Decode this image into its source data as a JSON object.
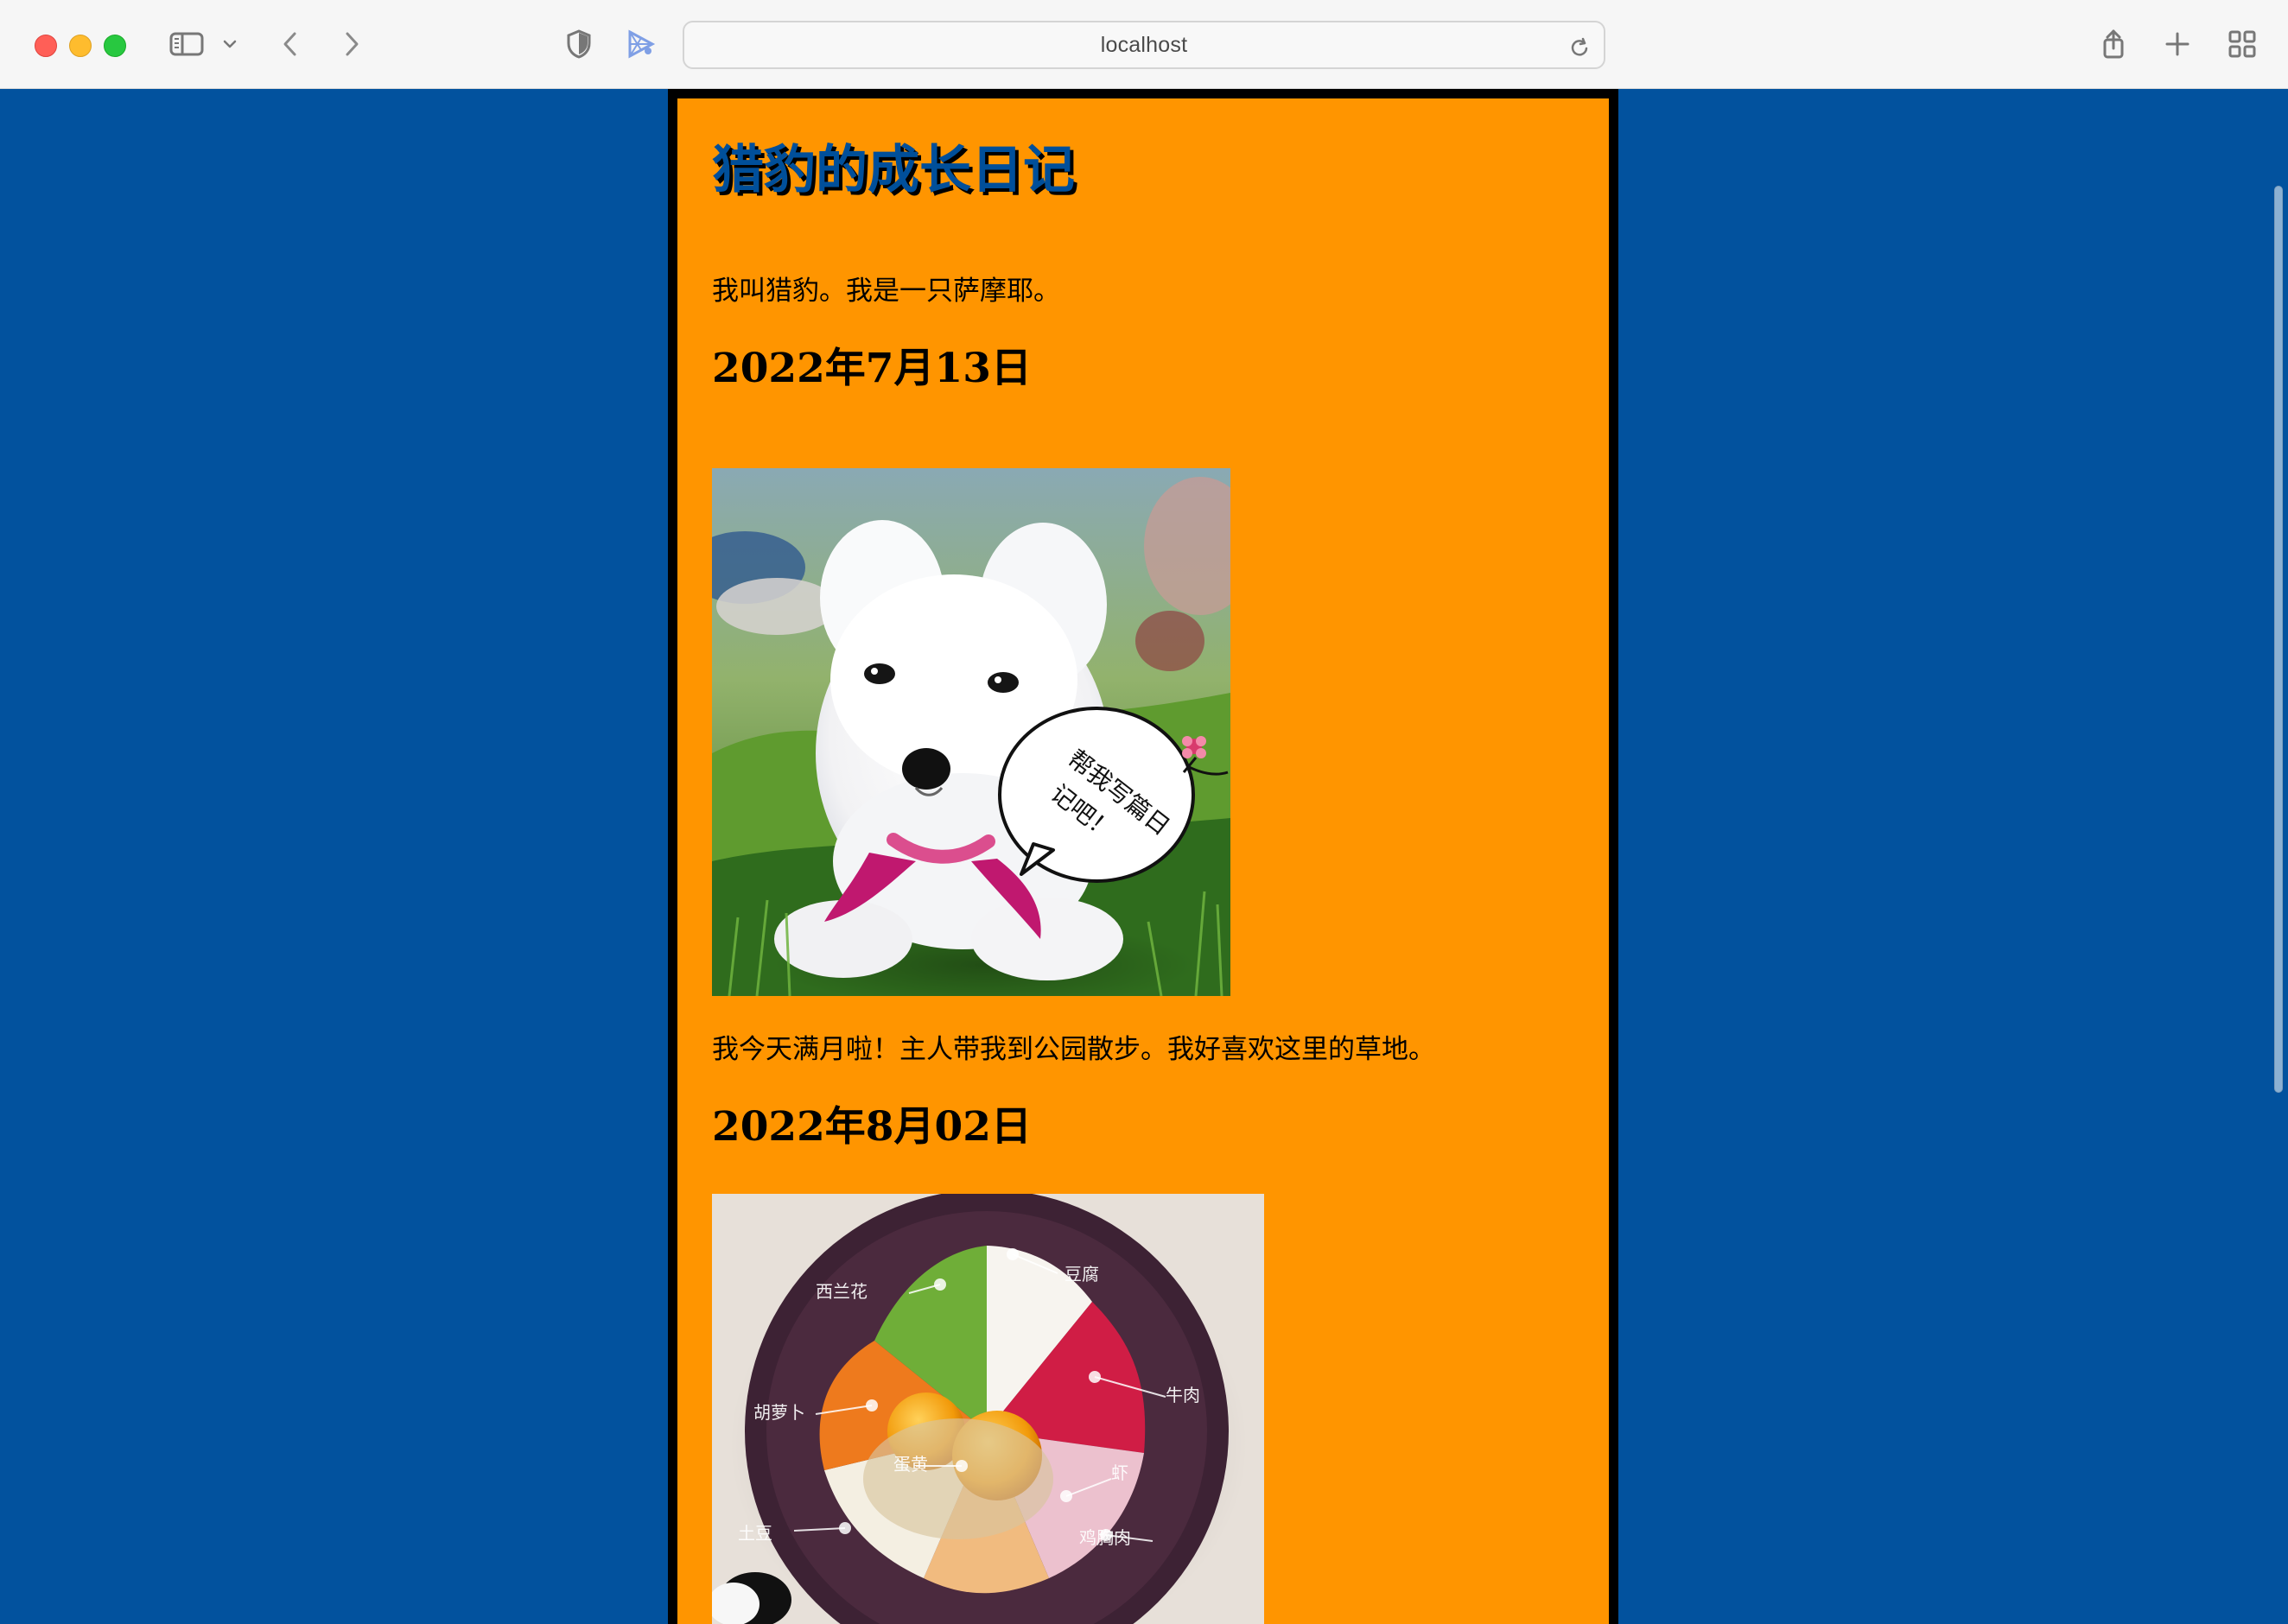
{
  "browser": {
    "address": "localhost"
  },
  "page": {
    "title": "猎豹的成长日记",
    "intro": "我叫猎豹。我是一只萨摩耶。",
    "entries": [
      {
        "date": "2022年7月13日",
        "text": "我今天满月啦！主人带我到公园散步。我好喜欢这里的草地。"
      },
      {
        "date": "2022年8月02日"
      }
    ]
  },
  "colors": {
    "browser_chrome": "#f6f6f6",
    "page_background": "#02529e",
    "diary_background": "#ff9500",
    "diary_border": "#000000",
    "title_color": "#004f9a"
  },
  "icons": {
    "sidebar": "sidebar-icon",
    "dropdown": "chevron-down-icon",
    "back": "chevron-left-icon",
    "forward": "chevron-right-icon",
    "privacy": "shield-icon",
    "extension": "extension-icon",
    "reload": "reload-icon",
    "share": "share-icon",
    "new_tab": "plus-icon",
    "tabs": "tabs-grid-icon"
  }
}
